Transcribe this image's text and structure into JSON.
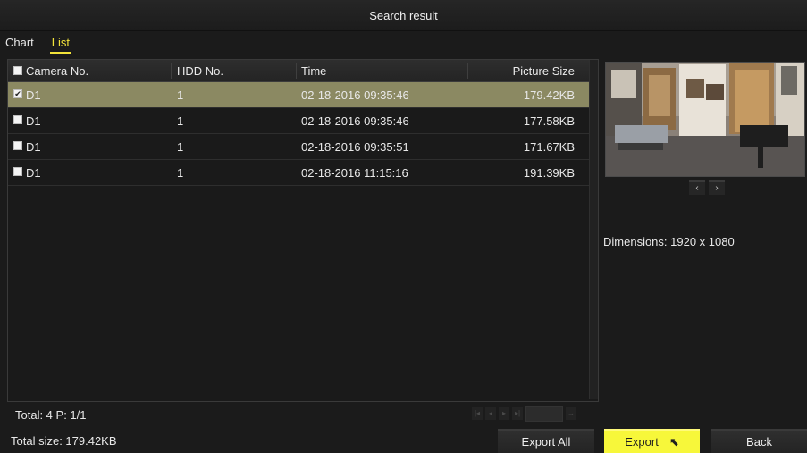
{
  "title": "Search result",
  "tabs": [
    {
      "label": "Chart",
      "active": false
    },
    {
      "label": "List",
      "active": true
    }
  ],
  "table": {
    "columns": [
      "Camera No.",
      "HDD No.",
      "Time",
      "Picture Size"
    ],
    "rows": [
      {
        "camera": "D1",
        "hdd": "1",
        "time": "02-18-2016 09:35:46",
        "size": "179.42KB",
        "checked": true,
        "selected": true
      },
      {
        "camera": "D1",
        "hdd": "1",
        "time": "02-18-2016 09:35:46",
        "size": "177.58KB",
        "checked": false,
        "selected": false
      },
      {
        "camera": "D1",
        "hdd": "1",
        "time": "02-18-2016 09:35:51",
        "size": "171.67KB",
        "checked": false,
        "selected": false
      },
      {
        "camera": "D1",
        "hdd": "1",
        "time": "02-18-2016 11:15:16",
        "size": "191.39KB",
        "checked": false,
        "selected": false
      }
    ]
  },
  "footer": {
    "total": "Total: 4  P: 1/1",
    "total_size": "Total size: 179.42KB"
  },
  "preview": {
    "dimensions": "Dimensions: 1920 x 1080",
    "prev_icon": "chevron-left-icon",
    "next_icon": "chevron-right-icon",
    "next_glyph": "›",
    "prev_glyph": "‹"
  },
  "buttons": {
    "export_all": "Export All",
    "export": "Export",
    "back": "Back"
  },
  "colors": {
    "selected_row": "#8b8962",
    "accent_yellow": "#f7f73a",
    "active_tab": "#f2e33a"
  }
}
